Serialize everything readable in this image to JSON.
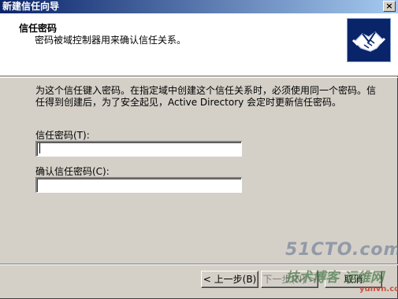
{
  "window": {
    "title": "新建信任向导",
    "close_glyph": "×"
  },
  "header": {
    "title": "信任密码",
    "subtitle": "密码被域控制器用来确认信任关系。",
    "icon": "handshake-icon"
  },
  "body": {
    "description": "为这个信任键入密码。在指定域中创建这个信任关系时，必须使用同一个密码。信任得到创建后，为了安全起见，Active Directory 会定时更新信任密码。",
    "password_label": "信任密码(T):",
    "password_value": "",
    "confirm_label": "确认信任密码(C):",
    "confirm_value": ""
  },
  "buttons": {
    "back": "< 上一步(B)",
    "next": "下一步(N) >",
    "cancel": "取消"
  },
  "watermark": {
    "site1": "51CTO.com",
    "site2": "技术博客 运维网",
    "site3": "yunvn.com"
  },
  "colors": {
    "titlebar": "#0a246a",
    "dialog": "#d4d0c8",
    "header": "#ffffff"
  }
}
